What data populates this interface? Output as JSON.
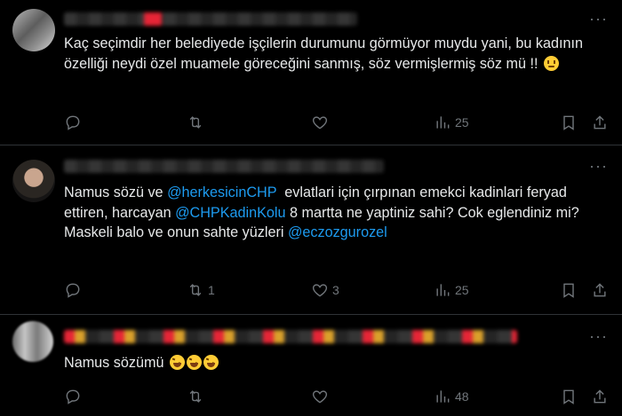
{
  "posts": [
    {
      "text": "Kaç seçimdir her belediyede işçilerin durumunu görmüyor muydu yani, bu kadının özelliği neydi özel muamele göreceğini sanmış, söz vermişlermiş söz mü !! ",
      "emoji": "rolling-eyes-emoji",
      "stats": {
        "reply": "",
        "repost": "",
        "like": "",
        "views": "25"
      }
    },
    {
      "segments": [
        {
          "text": "Namus sözü ve ",
          "mention": false
        },
        {
          "text": "@herkesicinCHP",
          "mention": true
        },
        {
          "text": "  evlatlari için çırpınan emekci kadinlari feryad ettiren, harcayan ",
          "mention": false
        },
        {
          "text": "@CHPKadinKolu",
          "mention": true
        },
        {
          "text": " 8 martta ne yaptiniz sahi? Cok eglendiniz mi?\nMaskeli balo ve onun sahte yüzleri ",
          "mention": false
        },
        {
          "text": "@eczozgurozel",
          "mention": true
        }
      ],
      "stats": {
        "reply": "",
        "repost": "1",
        "like": "3",
        "views": "25"
      }
    },
    {
      "text": "Namus sözümü ",
      "emoji": "rolling-on-floor-laughing-emoji",
      "stats": {
        "reply": "",
        "repost": "",
        "like": "",
        "views": "48"
      }
    }
  ],
  "more_label": "···",
  "colors": {
    "background": "#000000",
    "text": "#e7e9ea",
    "muted": "#71767b",
    "link": "#1d9bf0",
    "divider": "#2f3336"
  }
}
